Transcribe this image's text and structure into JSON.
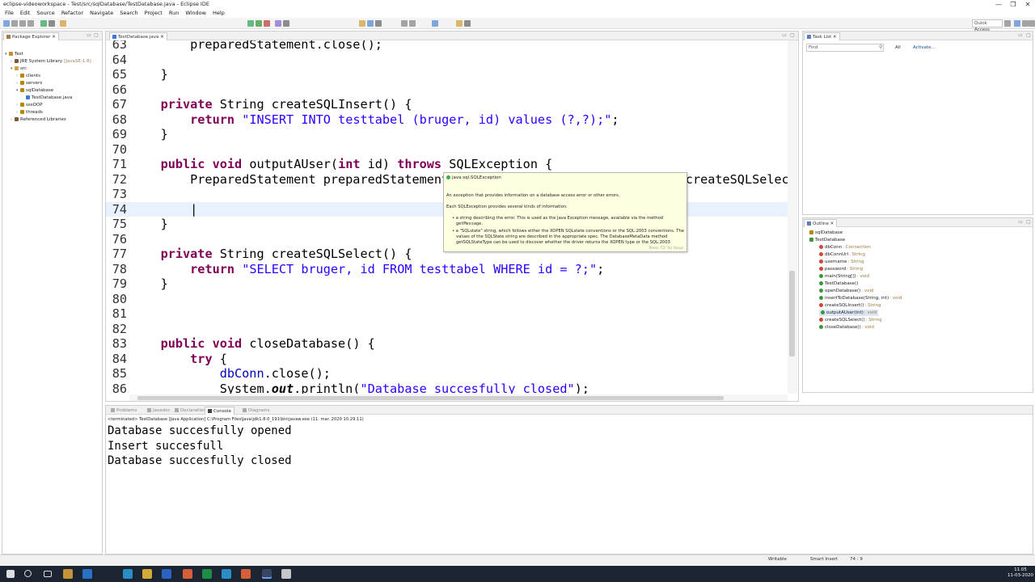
{
  "window": {
    "title": "eclipse-videoworkspace - Test/src/sqlDatabase/TestDatabase.java - Eclipse IDE",
    "minimize": "—",
    "maximize": "❐",
    "close": "✕"
  },
  "menu": [
    "File",
    "Edit",
    "Source",
    "Refactor",
    "Navigate",
    "Search",
    "Project",
    "Run",
    "Window",
    "Help"
  ],
  "toolbar": {
    "quick_access": "Quick Access"
  },
  "package_explorer": {
    "tab": "Package Explorer",
    "items": [
      {
        "label": "Test",
        "indent": 0,
        "icon": "project-icon",
        "color": "#c98b2b"
      },
      {
        "label": "JRE System Library",
        "extra": "[JavaSE-1.8]",
        "indent": 1,
        "icon": "library-icon",
        "color": "#7a5a3a"
      },
      {
        "label": "src",
        "indent": 1,
        "icon": "folder-icon",
        "color": "#c9a43a"
      },
      {
        "label": "clients",
        "indent": 2,
        "icon": "package-icon",
        "color": "#b8860b"
      },
      {
        "label": "servers",
        "indent": 2,
        "icon": "package-icon",
        "color": "#b8860b"
      },
      {
        "label": "sqlDatabase",
        "indent": 2,
        "icon": "package-icon",
        "color": "#b8860b"
      },
      {
        "label": "TestDatabase.java",
        "indent": 3,
        "icon": "java-file-icon",
        "color": "#3a7bd5"
      },
      {
        "label": "sssOOP",
        "indent": 2,
        "icon": "package-icon",
        "color": "#b8860b"
      },
      {
        "label": "threads",
        "indent": 2,
        "icon": "package-icon",
        "color": "#b8860b"
      },
      {
        "label": "Referenced Libraries",
        "indent": 1,
        "icon": "library-icon",
        "color": "#7a5a3a"
      }
    ]
  },
  "editor": {
    "tab": "TestDatabase.java",
    "lines": [
      {
        "n": "63",
        "html": "        preparedStatement.close();"
      },
      {
        "n": "64",
        "html": ""
      },
      {
        "n": "65",
        "html": "    }"
      },
      {
        "n": "66",
        "html": ""
      },
      {
        "n": "67",
        "html": "    <span class='kw'>private</span> String createSQLInsert() {"
      },
      {
        "n": "68",
        "html": "        <span class='kw'>return</span> <span class='str'>\"INSERT INTO testtabel (bruger, id) values (?,?);\"</span>;"
      },
      {
        "n": "69",
        "html": "    }"
      },
      {
        "n": "70",
        "html": ""
      },
      {
        "n": "71",
        "html": "    <span class='kw'>public</span> <span class='kw'>void</span> outputAUser(<span class='kw'>int</span> id) <span class='kw'>throws</span> SQLException {"
      },
      {
        "n": "72",
        "html": "        PreparedStatement preparedStatement = <span class='fld'>dbConn</span>.prepareStatement(<span class='kw'>this</span>.createSQLSelect());"
      },
      {
        "n": "73",
        "html": ""
      },
      {
        "n": "74",
        "html": "        |"
      },
      {
        "n": "75",
        "html": "    }"
      },
      {
        "n": "76",
        "html": ""
      },
      {
        "n": "77",
        "html": "    <span class='kw'>private</span> String createSQLSelect() {"
      },
      {
        "n": "78",
        "html": "        <span class='kw'>return</span> <span class='str'>\"SELECT bruger, id FROM testtabel WHERE id = ?;\"</span>;"
      },
      {
        "n": "79",
        "html": "    }"
      },
      {
        "n": "80",
        "html": ""
      },
      {
        "n": "81",
        "html": ""
      },
      {
        "n": "82",
        "html": ""
      },
      {
        "n": "83",
        "html": "    <span class='kw'>public</span> <span class='kw'>void</span> closeDatabase() {"
      },
      {
        "n": "84",
        "html": "        <span class='kw'>try</span> {"
      },
      {
        "n": "85",
        "html": "            <span class='fld'>dbConn</span>.close();"
      },
      {
        "n": "86",
        "html": "            System.<span class='itl'>out</span>.println(<span class='str'>\"Database succesfully closed\"</span>);"
      }
    ],
    "current_line": "74"
  },
  "hover": {
    "header": "java.sql.SQLException",
    "desc": "An exception that provides information on a database access error or other errors.",
    "each": "Each SQLException provides several kinds of information:",
    "bullet1": "• a string describing the error. This is used as the Java Exception message, available via the method",
    "bullet1b": "getMessage.",
    "bullet2": "• a \"SQLstate\" string, which follows either the XOPEN SQLstate conventions or the SQL:2003 conventions. The",
    "bullet2b": "values of the SQLState string are described in the appropriate spec. The DatabaseMetaData method",
    "bullet2c": "getSQLStateType can be used to discover whether the driver returns the XOPEN type or the SQL:2003",
    "footer": "Press 'F2' for focus"
  },
  "tasklist": {
    "tab": "Task List",
    "find": "Find",
    "all": "All",
    "activate": "Activate..."
  },
  "outline": {
    "tab": "Outline",
    "items": [
      {
        "label": "sqlDatabase",
        "type": "",
        "indent": 0,
        "color": "#b8860b"
      },
      {
        "label": "TestDatabase",
        "type": "",
        "indent": 0,
        "color": "#3a9a3a"
      },
      {
        "label": "dbConn",
        "type": ": Connection",
        "indent": 1,
        "color": "#d0463b"
      },
      {
        "label": "dbConnUrl",
        "type": ": String",
        "indent": 1,
        "color": "#d0463b"
      },
      {
        "label": "username",
        "type": ": String",
        "indent": 1,
        "color": "#d0463b"
      },
      {
        "label": "password",
        "type": ": String",
        "indent": 1,
        "color": "#d0463b"
      },
      {
        "label": "main(String[])",
        "type": ": void",
        "indent": 1,
        "color": "#3a9a3a"
      },
      {
        "label": "TestDatabase()",
        "type": "",
        "indent": 1,
        "color": "#3a9a3a"
      },
      {
        "label": "openDatabase()",
        "type": ": void",
        "indent": 1,
        "color": "#3a9a3a"
      },
      {
        "label": "insertToDatabase(String, int)",
        "type": ": void",
        "indent": 1,
        "color": "#3a9a3a"
      },
      {
        "label": "createSQLInsert()",
        "type": ": String",
        "indent": 1,
        "color": "#d0463b"
      },
      {
        "label": "outputAUser(int)",
        "type": ": void",
        "indent": 1,
        "color": "#3a9a3a"
      },
      {
        "label": "createSQLSelect()",
        "type": ": String",
        "indent": 1,
        "color": "#d0463b"
      },
      {
        "label": "closeDatabase()",
        "type": ": void",
        "indent": 1,
        "color": "#3a9a3a"
      }
    ],
    "selected": 11
  },
  "console": {
    "tabs": [
      "Problems",
      "Javadoc",
      "Declaration",
      "Console",
      "Diagrams"
    ],
    "active_tab": 3,
    "terminated": "<terminated> TestDatabase [Java Application] C:\\Program Files\\Java\\jdk1.8.0_191\\bin\\javaw.exe (11. mar. 2020 10.29.11)",
    "lines": [
      "Database succesfully opened",
      "Insert succesfull",
      "Database succesfully closed"
    ]
  },
  "statusbar": {
    "writable": "Writable",
    "insert_mode": "Smart Insert",
    "position": "74 : 9"
  },
  "taskbar": {
    "time": "11.05",
    "date": "11-03-2020"
  }
}
